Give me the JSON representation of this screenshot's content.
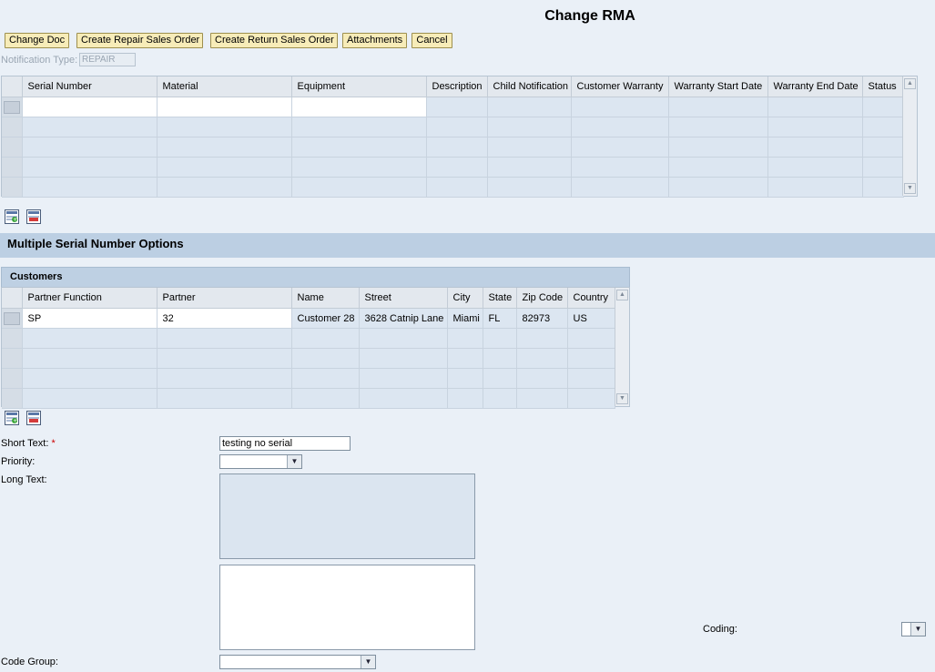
{
  "title": "Change RMA",
  "toolbar": {
    "change_doc": "Change Doc",
    "create_repair": "Create Repair Sales Order",
    "create_return": "Create Return Sales Order",
    "attachments": "Attachments",
    "cancel": "Cancel"
  },
  "notification": {
    "label": "Notification Type:",
    "value": "REPAIR"
  },
  "serial_table": {
    "columns": [
      "Serial Number",
      "Material",
      "Equipment",
      "Description",
      "Child Notification",
      "Customer Warranty",
      "Warranty Start Date",
      "Warranty End Date",
      "Status"
    ]
  },
  "section_title": "Multiple Serial Number Options",
  "customers": {
    "title": "Customers",
    "columns": [
      "Partner Function",
      "Partner",
      "Name",
      "Street",
      "City",
      "State",
      "Zip Code",
      "Country"
    ],
    "rows": [
      [
        "SP",
        "32",
        "Customer 28",
        "3628 Catnip Lane",
        "Miami",
        "FL",
        "82973",
        "US"
      ]
    ]
  },
  "form": {
    "short_text_label": "Short Text:",
    "required_mark": "*",
    "short_text_value": "testing no serial",
    "priority_label": "Priority:",
    "long_text_label": "Long Text:",
    "coding_label": "Coding:",
    "code_group_label": "Code Group:"
  },
  "icons": [
    "insert-row-icon",
    "delete-row-icon",
    "dropdown-arrow-icon",
    "scroll-up-icon",
    "scroll-down-icon"
  ]
}
